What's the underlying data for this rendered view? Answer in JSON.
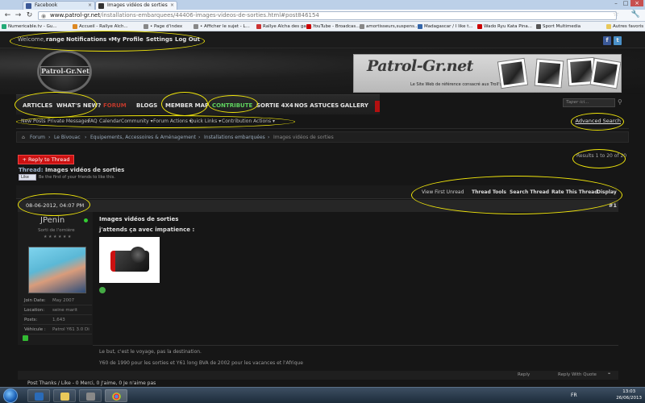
{
  "browser": {
    "tabs": [
      {
        "label": "Facebook",
        "active": false,
        "favicon_color": "#3b5998"
      },
      {
        "label": "Images vidéos de sorties",
        "active": true,
        "favicon_color": "#333333"
      }
    ],
    "url_host": "www.patrol-gr.net",
    "url_path": "/installations-embarquees/44406-images-videos-de-sorties.html#post846154",
    "bookmarks": [
      {
        "label": "Numericable.tv - Gu...",
        "color": "#2a7"
      },
      {
        "label": "Accueil - Rallye Aïch...",
        "color": "#d82"
      },
      {
        "label": "• Page d'index",
        "color": "#888"
      },
      {
        "label": "• Afficher le sujet - L...",
        "color": "#888"
      },
      {
        "label": "Rallye Aïcha des gaz...",
        "color": "#c33"
      },
      {
        "label": "YouTube - Broadcas...",
        "color": "#c00"
      },
      {
        "label": "amortisseurs,suspens...",
        "color": "#888"
      },
      {
        "label": "Madagascar / I like t...",
        "color": "#36a"
      },
      {
        "label": "Wado Ryu Kata Pina...",
        "color": "#c00"
      },
      {
        "label": "Sport Multimedia",
        "color": "#555"
      }
    ],
    "other_bookmarks": "Autres favoris"
  },
  "userbar": {
    "welcome": "Welcome,",
    "username": "range",
    "notifications": "Notifications ▾",
    "profile": "My Profile",
    "settings": "Settings",
    "logout": "Log Out"
  },
  "header": {
    "logo_text": "Patrol-Gr.Net",
    "banner_title": "Patrol-Gr.net",
    "banner_subtitle": "Le Site Web de référence consacré aux Troll's"
  },
  "nav": {
    "items": [
      {
        "label": "ARTICLES",
        "style": ""
      },
      {
        "label": "WHAT'S NEW?",
        "style": ""
      },
      {
        "label": "FORUM",
        "style": "red"
      },
      {
        "label": "BLOGS",
        "style": ""
      },
      {
        "label": "MEMBER MAP",
        "style": ""
      },
      {
        "label": "CONTRIBUTE",
        "style": "green"
      },
      {
        "label": "SORTIE 4X4",
        "style": ""
      },
      {
        "label": "NOS ASTUCES",
        "style": ""
      },
      {
        "label": "GALLERY",
        "style": ""
      }
    ],
    "search_placeholder": "Taper ici..."
  },
  "subnav": {
    "items": [
      "New Posts",
      "Private Messages",
      "FAQ",
      "Calendar",
      "Community ▾",
      "Forum Actions ▾",
      "Quick Links ▾",
      "Contribution Actions ▾"
    ],
    "advanced_search": "Advanced Search"
  },
  "breadcrumb": [
    "Forum",
    "Le Bivouac",
    "Equipements, Accessoires & Aménagement",
    "Installations embarquées",
    "Images vidéos de sorties"
  ],
  "thread": {
    "reply_button": "+ Reply to Thread",
    "results": "Results 1 to 20 of 20",
    "label": "Thread:",
    "title": "Images vidéos de sorties",
    "like": "Like",
    "like_text": "Be the first of your friends to like this.",
    "tools": [
      "View First Unread",
      "Thread Tools",
      "Search Thread",
      "Rate This Thread",
      "Display"
    ]
  },
  "post": {
    "date": "08-06-2012, 04:07 PM",
    "number": "#1",
    "author": "JPenin",
    "user_title": "Sorti de l'ornière",
    "stars": "★★★★★★",
    "info": [
      {
        "key": "Join Date:",
        "value": "May 2007"
      },
      {
        "key": "Location:",
        "value": "seine marit"
      },
      {
        "key": "Posts:",
        "value": "1,643"
      },
      {
        "key": "Véhicule :",
        "value": "Patrol Y61 3.0 Di"
      }
    ],
    "title": "Images vidéos de sorties",
    "text": "j'attends ça avec impatience :",
    "signature_line1": "Le but, c'est le voyage, pas la destination.",
    "signature_line2": "Y60 de 1990 pour les sorties et Y61 long BVA de 2002 pour les vacances et l'Afrique",
    "reply": "Reply",
    "reply_quote": "Reply With Quote",
    "thanks_line1": "Post Thanks / Like - 0 Merci, 0 J'aime, 0 Je n'aime pas"
  },
  "taskbar": {
    "lang": "FR",
    "time": "13:03",
    "date": "26/06/2013"
  },
  "colors": {
    "brand_red": "#c0392b",
    "contribute_green": "#5fd35f",
    "annotation_yellow": "#f1e60c"
  }
}
